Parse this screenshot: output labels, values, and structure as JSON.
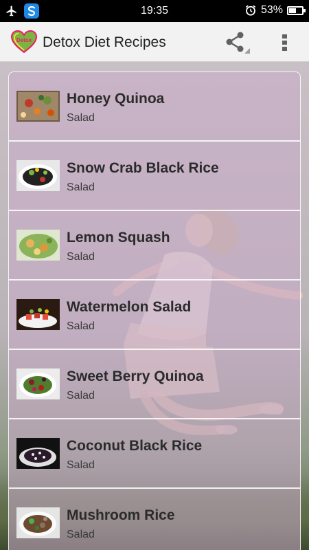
{
  "status_bar": {
    "time": "19:35",
    "battery_percent_text": "53%",
    "battery_level": 0.53,
    "icons": [
      "airplane-icon",
      "sync-app-icon",
      "alarm-clock-icon",
      "battery-icon"
    ]
  },
  "app_bar": {
    "logo_text": "Detox",
    "title": "Detox Diet Recipes",
    "icons": [
      "share-icon",
      "overflow-menu-icon"
    ]
  },
  "recipes": [
    {
      "name": "Honey Quinoa",
      "category": "Salad"
    },
    {
      "name": "Snow Crab Black Rice",
      "category": "Salad"
    },
    {
      "name": "Lemon Squash",
      "category": "Salad"
    },
    {
      "name": "Watermelon Salad",
      "category": "Salad"
    },
    {
      "name": "Sweet Berry Quinoa",
      "category": "Salad"
    },
    {
      "name": "Coconut Black Rice",
      "category": "Salad"
    },
    {
      "name": "Mushroom Rice",
      "category": "Salad"
    }
  ],
  "colors": {
    "app_bar_bg": "#f2f2f2",
    "list_overlay": "#c8aac8",
    "text_primary": "#2b2b2b"
  }
}
